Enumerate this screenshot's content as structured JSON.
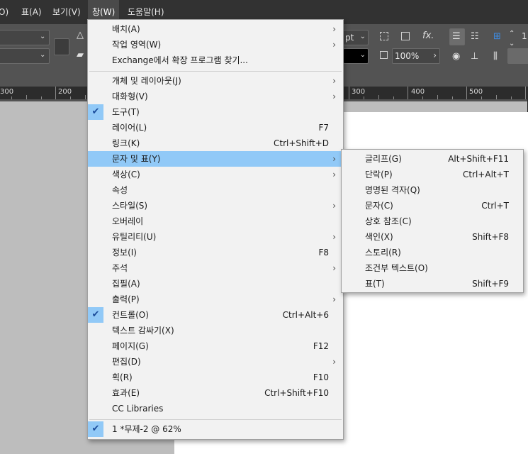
{
  "menubar": {
    "items": [
      {
        "label": "O)"
      },
      {
        "label": "표(A)"
      },
      {
        "label": "보기(V)"
      },
      {
        "label": "창(W)"
      },
      {
        "label": "도움말(H)"
      }
    ]
  },
  "control": {
    "pt_label": "pt",
    "zoom_value": "100%",
    "fx_label": "fx."
  },
  "ruler": {
    "labels": [
      "300",
      "200",
      "300",
      "400",
      "500"
    ]
  },
  "window_menu": {
    "items": [
      {
        "label": "배치(A)",
        "shortcut": "",
        "submenu": true
      },
      {
        "label": "작업 영역(W)",
        "shortcut": "",
        "submenu": true
      },
      {
        "label": "Exchange에서 확장 프로그램 찾기...",
        "shortcut": "",
        "submenu": false
      },
      {
        "label": "개체 및 레이아웃(J)",
        "shortcut": "",
        "submenu": true
      },
      {
        "label": "대화형(V)",
        "shortcut": "",
        "submenu": true
      },
      {
        "label": "도구(T)",
        "shortcut": "",
        "submenu": false,
        "checked": true
      },
      {
        "label": "레이어(L)",
        "shortcut": "F7",
        "submenu": false
      },
      {
        "label": "링크(K)",
        "shortcut": "Ctrl+Shift+D",
        "submenu": false
      },
      {
        "label": "문자 및 표(Y)",
        "shortcut": "",
        "submenu": true,
        "highlighted": true
      },
      {
        "label": "색상(C)",
        "shortcut": "",
        "submenu": true
      },
      {
        "label": "속성",
        "shortcut": "",
        "submenu": false
      },
      {
        "label": "스타일(S)",
        "shortcut": "",
        "submenu": true
      },
      {
        "label": "오버레이",
        "shortcut": "",
        "submenu": false
      },
      {
        "label": "유틸리티(U)",
        "shortcut": "",
        "submenu": true
      },
      {
        "label": "정보(I)",
        "shortcut": "F8",
        "submenu": false
      },
      {
        "label": "주석",
        "shortcut": "",
        "submenu": true
      },
      {
        "label": "집필(A)",
        "shortcut": "",
        "submenu": false
      },
      {
        "label": "출력(P)",
        "shortcut": "",
        "submenu": true
      },
      {
        "label": "컨트롤(O)",
        "shortcut": "Ctrl+Alt+6",
        "submenu": false,
        "checked": true
      },
      {
        "label": "텍스트 감싸기(X)",
        "shortcut": "",
        "submenu": false
      },
      {
        "label": "페이지(G)",
        "shortcut": "F12",
        "submenu": false
      },
      {
        "label": "편집(D)",
        "shortcut": "",
        "submenu": true
      },
      {
        "label": "획(R)",
        "shortcut": "F10",
        "submenu": false
      },
      {
        "label": "효과(E)",
        "shortcut": "Ctrl+Shift+F10",
        "submenu": false
      },
      {
        "label": "CC Libraries",
        "shortcut": "",
        "submenu": false
      },
      {
        "label": "1 *무제-2 @ 62%",
        "shortcut": "",
        "submenu": false,
        "checked": true
      }
    ]
  },
  "type_tables_submenu": {
    "items": [
      {
        "label": "글리프(G)",
        "shortcut": "Alt+Shift+F11"
      },
      {
        "label": "단락(P)",
        "shortcut": "Ctrl+Alt+T"
      },
      {
        "label": "명명된 격자(Q)",
        "shortcut": ""
      },
      {
        "label": "문자(C)",
        "shortcut": "Ctrl+T"
      },
      {
        "label": "상호 참조(C)",
        "shortcut": ""
      },
      {
        "label": "색인(X)",
        "shortcut": "Shift+F8"
      },
      {
        "label": "스토리(R)",
        "shortcut": ""
      },
      {
        "label": "조건부 텍스트(O)",
        "shortcut": ""
      },
      {
        "label": "표(T)",
        "shortcut": "Shift+F9"
      }
    ]
  },
  "icons": {
    "submenu_arrow": "chevron-right-icon",
    "check": "check-icon"
  }
}
